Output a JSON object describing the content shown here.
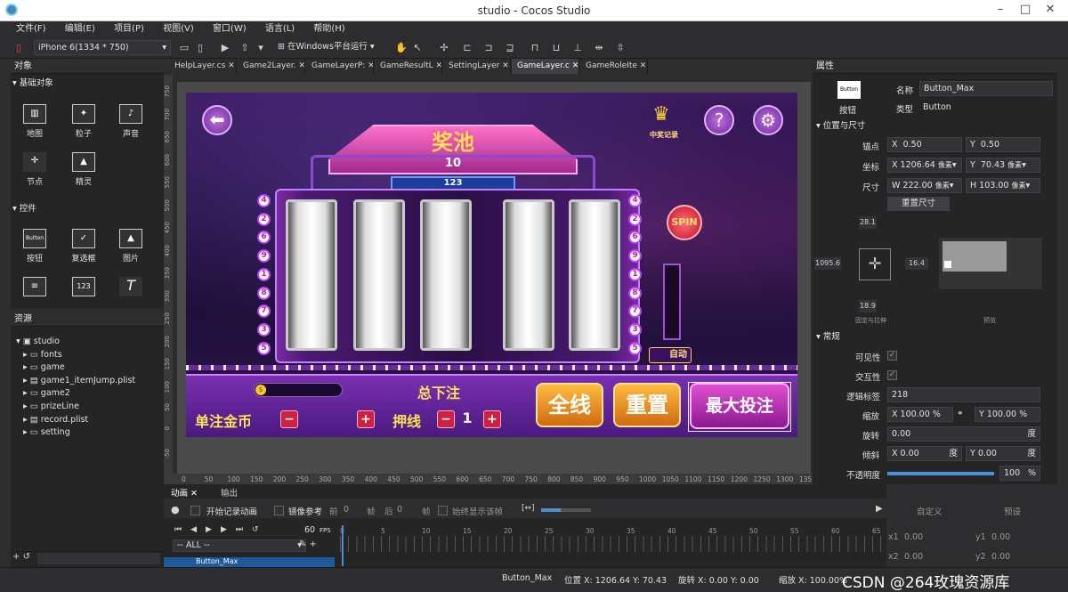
{
  "window": {
    "title": "studio - Cocos Studio"
  },
  "menu": [
    "文件(F)",
    "编辑(E)",
    "项目(P)",
    "视图(V)",
    "窗口(W)",
    "语言(L)",
    "帮助(H)"
  ],
  "toolbar": {
    "device": "iPhone 6(1334 * 750)",
    "run_target": "在Windows平台运行"
  },
  "objects_panel": {
    "title": "对象",
    "basic_section": "基础对象",
    "basic_items": [
      "地图",
      "粒子",
      "声音",
      "节点",
      "精灵"
    ],
    "controls_section": "控件",
    "control_items": [
      "按钮",
      "复选框",
      "图片"
    ],
    "button_icon_text": "Button",
    "label_icon_text": "123"
  },
  "resources_panel": {
    "title": "资源",
    "items": [
      "studio",
      "fonts",
      "game",
      "game1_itemJump.plist",
      "game2",
      "prizeLine",
      "record.plist",
      "setting"
    ]
  },
  "tabs": [
    "HelpLayer.cs",
    "Game2Layer.",
    "GameLayerP:",
    "GameResultL",
    "SettingLayer",
    "GameLayer.c",
    "GameRoleIte"
  ],
  "ruler": {
    "h": [
      "0",
      "50",
      "100",
      "150",
      "200",
      "250",
      "300",
      "350",
      "400",
      "450",
      "500",
      "550",
      "600",
      "650",
      "700",
      "750",
      "800",
      "850",
      "900",
      "950",
      "1000",
      "1050",
      "1100",
      "1150",
      "1200",
      "1250",
      "1300",
      "135"
    ],
    "v": [
      "750",
      "700",
      "650",
      "600",
      "550",
      "500",
      "450",
      "400",
      "350",
      "300",
      "250",
      "200",
      "150",
      "100",
      "50",
      "0",
      "-50"
    ]
  },
  "game": {
    "jackpot_title": "奖池",
    "jackpot_value": "10",
    "counter": "123",
    "record_label": "中奖记录",
    "spin": "SPIN",
    "auto": "自动",
    "total_bet": "总下注",
    "single_coin": "单注金币",
    "bet_line": "押线",
    "bet_line_value": "1",
    "btn_all": "全线",
    "btn_reset": "重置",
    "btn_max": "最大投注",
    "left_nums": [
      "4",
      "2",
      "6",
      "9",
      "1",
      "8",
      "7",
      "3",
      "5"
    ],
    "right_nums": [
      "4",
      "2",
      "6",
      "9",
      "1",
      "8",
      "7",
      "3",
      "5"
    ]
  },
  "animation_panel": {
    "tabs": [
      "动画",
      "输出"
    ],
    "record_label": "开始记录动画",
    "mirror_label": "镜像参考",
    "prev_label": "前",
    "prev_value": "0",
    "frame1": "帧",
    "next_label": "后",
    "next_value": "0",
    "frame2": "帧",
    "always_label": "始终显示该帧",
    "fps": "60",
    "fps_label": "FPS",
    "filter": "-- ALL --",
    "node": "Button_Max",
    "timeline_ticks": [
      "0",
      "5",
      "10",
      "15",
      "20",
      "25",
      "30",
      "35",
      "40",
      "45",
      "50",
      "55",
      "60",
      "65"
    ],
    "custom": "自定义",
    "preset": "预设",
    "x1": "x1",
    "x1v": "0.00",
    "y1": "y1",
    "y1v": "0.00",
    "x2": "x2",
    "x2v": "0.00",
    "y2": "y2",
    "y2v": "0.00"
  },
  "properties": {
    "title": "属性",
    "icon_text": "Button",
    "icon_caption": "按钮",
    "name_label": "名称",
    "name_value": "Button_Max",
    "type_label": "类型",
    "type_value": "Button",
    "pos_section": "位置与尺寸",
    "anchor_label": "锚点",
    "anchor_x": "0.50",
    "anchor_y": "0.50",
    "pos_label": "坐标",
    "pos_x": "1206.64",
    "pos_y": "70.43",
    "unit": "像素",
    "size_label": "尺寸",
    "w": "222.00",
    "h": "103.00",
    "reset_size": "重置尺寸",
    "layout_top": "28.1",
    "layout_left": "1095.6",
    "layout_right": "16.4",
    "layout_bottom": "18.9",
    "layout_caption": "固定与拉伸",
    "preview_caption": "预览",
    "general_section": "常规",
    "visible_label": "可见性",
    "interactive_label": "交互性",
    "tag_label": "逻辑标签",
    "tag_value": "218",
    "scale_label": "缩放",
    "scale_x": "100.00",
    "scale_y": "100.00",
    "pct": "%",
    "rotation_label": "旋转",
    "rotation_value": "0.00",
    "deg": "度",
    "skew_label": "倾斜",
    "skew_x": "0.00",
    "skew_y": "0.00",
    "opacity_label": "不透明度",
    "opacity_value": "100"
  },
  "status": {
    "node": "Button_Max",
    "position": "位置 X: 1206.64   Y: 70.43",
    "rotation": "旋转 X: 0.00   Y: 0.00",
    "scale": "缩放 X: 100.00%   Y: 100.00%",
    "watermark": "CSDN @264玫瑰资源库"
  }
}
